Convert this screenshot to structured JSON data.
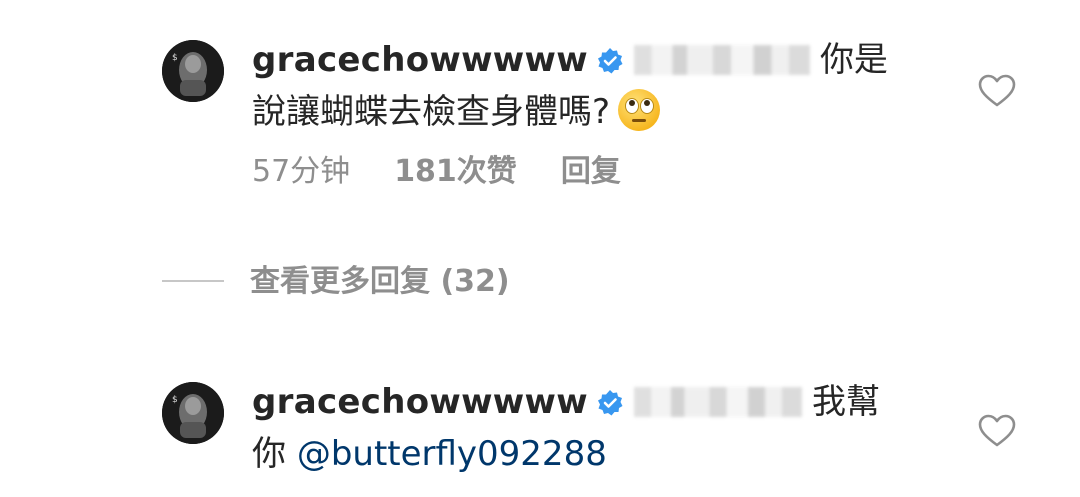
{
  "comments": [
    {
      "username": "gracechowwwww",
      "verified": true,
      "mention_redacted": "g_m_ei_a",
      "text_line1": "你是",
      "text_line2": "說讓蝴蝶去檢查身體嗎?",
      "emoji": "face-with-rolling-eyes",
      "time": "57分钟",
      "likes": "181次赞",
      "reply": "回复"
    },
    {
      "username": "gracechowwwww",
      "verified": true,
      "mention_redacted": "a_q_b_oo",
      "text_line1": "我幫",
      "text_line2_prefix": "你",
      "mention": "@butterfly092288"
    }
  ],
  "view_more_replies": "查看更多回复 (32)",
  "colors": {
    "text": "#262626",
    "secondary": "#8e8e8e",
    "verified_badge": "#3897f0",
    "mention": "#00376b"
  },
  "icons": [
    "verified-badge-icon",
    "heart-outline-icon",
    "avatar"
  ]
}
